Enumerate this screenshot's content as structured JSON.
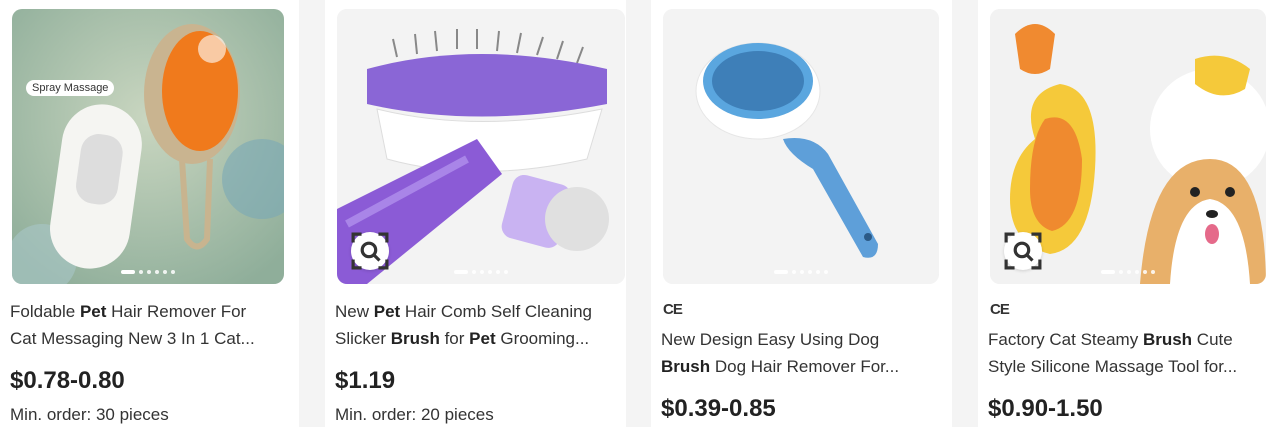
{
  "products": [
    {
      "badge": "Spray Massage",
      "title_parts": [
        [
          {
            "t": "Foldable ",
            "b": false
          },
          {
            "t": "Pet",
            "b": true
          },
          {
            "t": " Hair Remover For",
            "b": false
          }
        ],
        [
          {
            "t": "Cat Messaging New 3 In 1 Cat...",
            "b": false
          }
        ]
      ],
      "price": "$0.78-0.80",
      "min_order": "Min. order: 30 pieces"
    },
    {
      "title_parts": [
        [
          {
            "t": "New ",
            "b": false
          },
          {
            "t": "Pet",
            "b": true
          },
          {
            "t": " Hair Comb Self Cleaning",
            "b": false
          }
        ],
        [
          {
            "t": "Slicker ",
            "b": false
          },
          {
            "t": "Brush",
            "b": true
          },
          {
            "t": " for ",
            "b": false
          },
          {
            "t": "Pet",
            "b": true
          },
          {
            "t": " Grooming...",
            "b": false
          }
        ]
      ],
      "price": "$1.19",
      "min_order": "Min. order: 20 pieces"
    },
    {
      "cert": "CE",
      "title_parts": [
        [
          {
            "t": "New Design Easy Using Dog",
            "b": false
          }
        ],
        [
          {
            "t": "Brush",
            "b": true
          },
          {
            "t": " Dog Hair Remover For...",
            "b": false
          }
        ]
      ],
      "price": "$0.39-0.85"
    },
    {
      "cert": "CE",
      "title_parts": [
        [
          {
            "t": "Factory Cat Steamy ",
            "b": false
          },
          {
            "t": "Brush",
            "b": true
          },
          {
            "t": " Cute",
            "b": false
          }
        ],
        [
          {
            "t": "Style Silicone Massage Tool for...",
            "b": false
          }
        ]
      ],
      "price": "$0.90-1.50"
    }
  ]
}
